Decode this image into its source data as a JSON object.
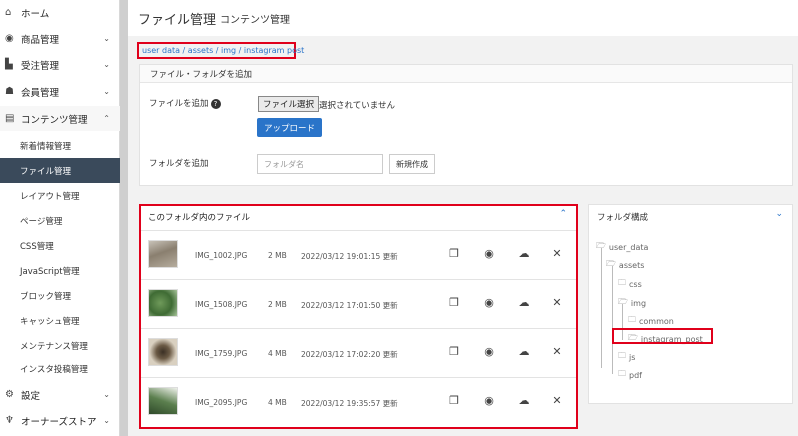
{
  "sidebar": {
    "items": [
      {
        "label": "ホーム",
        "icon": "home-icon",
        "glyph": "⌂",
        "chev": ""
      },
      {
        "label": "商品管理",
        "icon": "cube-icon",
        "glyph": "◉",
        "chev": "⌄"
      },
      {
        "label": "受注管理",
        "icon": "cart-icon",
        "glyph": "▙",
        "chev": "⌄"
      },
      {
        "label": "会員管理",
        "icon": "users-icon",
        "glyph": "☗",
        "chev": "⌄"
      },
      {
        "label": "コンテンツ管理",
        "icon": "file-icon",
        "glyph": "▤",
        "chev": "⌃"
      }
    ],
    "sub_items": [
      "新着情報管理",
      "ファイル管理",
      "レイアウト管理",
      "ページ管理",
      "CSS管理",
      "JavaScript管理",
      "ブロック管理",
      "キャッシュ管理",
      "メンテナンス管理",
      "インスタ投稿管理"
    ],
    "bottom_items": [
      {
        "label": "設定",
        "icon": "gear-icon",
        "glyph": "⚙",
        "chev": "⌄"
      },
      {
        "label": "オーナーズストア",
        "icon": "plug-icon",
        "glyph": "♆",
        "chev": "⌄"
      }
    ]
  },
  "header": {
    "title": "ファイル管理",
    "subtitle": "コンテンツ管理"
  },
  "breadcrumb": "user data / assets / img / instagram post",
  "upload_panel": {
    "title": "ファイル・フォルダを追加",
    "add_file_label": "ファイルを追加",
    "help_glyph": "?",
    "file_button": "ファイル選択",
    "file_status": "選択されていません",
    "upload_button": "アップロード",
    "add_folder_label": "フォルダを追加",
    "folder_placeholder": "フォルダ名",
    "new_button": "新規作成"
  },
  "files_panel": {
    "title": "このフォルダ内のファイル",
    "chevron": "⌃",
    "files": [
      {
        "name": "IMG_1002.JPG",
        "size": "2 MB",
        "date": "2022/03/12 19:01:15 更新"
      },
      {
        "name": "IMG_1508.JPG",
        "size": "2 MB",
        "date": "2022/03/12 17:01:50 更新"
      },
      {
        "name": "IMG_1759.JPG",
        "size": "4 MB",
        "date": "2022/03/12 17:02:20 更新"
      },
      {
        "name": "IMG_2095.JPG",
        "size": "4 MB",
        "date": "2022/03/12 19:35:57 更新"
      }
    ]
  },
  "folder_panel": {
    "title": "フォルダ構成",
    "chevron": "⌄",
    "tree": [
      {
        "label": "user_data"
      },
      {
        "label": "assets"
      },
      {
        "label": "css"
      },
      {
        "label": "img"
      },
      {
        "label": "common"
      },
      {
        "label": "instagram_post"
      },
      {
        "label": "js"
      },
      {
        "label": "pdf"
      }
    ]
  },
  "colors": {
    "accent": "#2a74c9",
    "sidebar_active": "#3a4a5b",
    "highlight_border": "#e0001b"
  }
}
